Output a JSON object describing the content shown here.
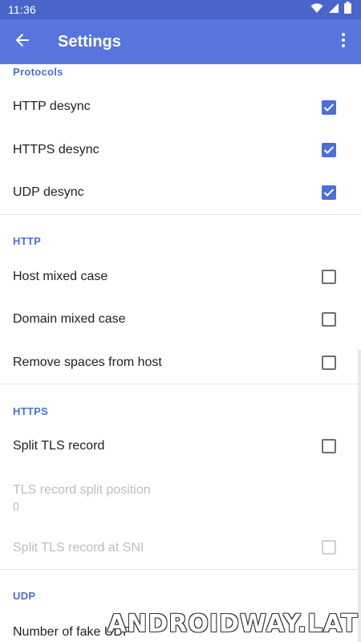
{
  "status_bar": {
    "time": "11:36",
    "icons": [
      "wifi-icon",
      "signal-icon",
      "battery-icon"
    ]
  },
  "app_bar": {
    "title": "Settings",
    "back_icon": "arrow-back-icon",
    "menu_icon": "more-vert-icon"
  },
  "colors": {
    "accent": "#4a6fd6",
    "app_bar": "#5875de",
    "status_bar": "#4a65c9"
  },
  "sections": {
    "protocols": {
      "header": "Protocols",
      "items": [
        {
          "title": "HTTP desync",
          "checked": true
        },
        {
          "title": "HTTPS desync",
          "checked": true
        },
        {
          "title": "UDP desync",
          "checked": true
        }
      ]
    },
    "http": {
      "header": "HTTP",
      "items": [
        {
          "title": "Host mixed case",
          "checked": false
        },
        {
          "title": "Domain mixed case",
          "checked": false
        },
        {
          "title": "Remove spaces from host",
          "checked": false
        }
      ]
    },
    "https": {
      "header": "HTTPS",
      "items": [
        {
          "title": "Split TLS record",
          "checked": false
        },
        {
          "title": "TLS record split position",
          "summary": "0",
          "enabled": false
        },
        {
          "title": "Split TLS record at SNI",
          "checked": false,
          "enabled": false
        }
      ]
    },
    "udp": {
      "header": "UDP",
      "items": [
        {
          "title": "Number of fake UDP"
        }
      ]
    }
  },
  "watermark": "ANDROIDWAY.LAT"
}
